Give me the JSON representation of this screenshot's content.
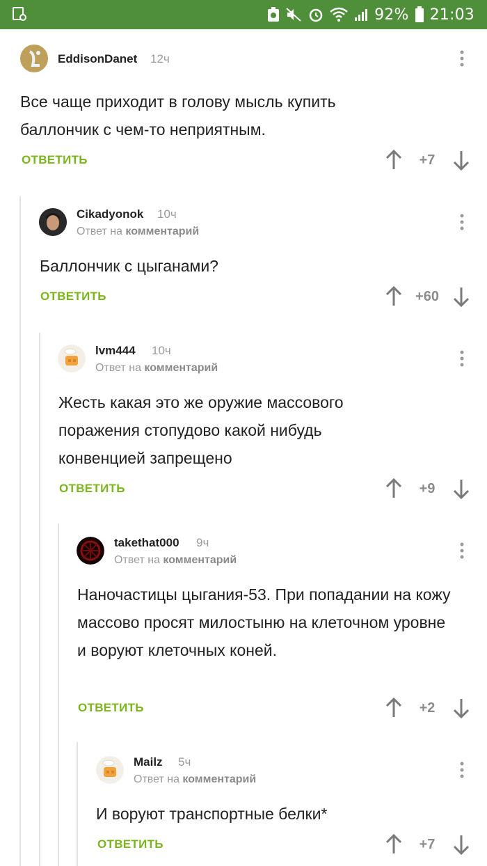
{
  "statusbar": {
    "battery": "92%",
    "time": "21:03"
  },
  "comments": [
    {
      "username": "EddisonDanet",
      "time": "12ч",
      "reply_to": "",
      "body": "Все чаще приходит в голову мысль купить баллончик с чем-то неприятным.",
      "reply_label": "ОТВЕТИТЬ",
      "score": "+7"
    },
    {
      "username": "Cikadyonok",
      "time": "10ч",
      "reply_to_prefix": "Ответ на",
      "reply_to": "комментарий",
      "body": "Баллончик с цыганами?",
      "reply_label": "ОТВЕТИТЬ",
      "score": "+60"
    },
    {
      "username": "lvm444",
      "time": "10ч",
      "reply_to_prefix": "Ответ на",
      "reply_to": "комментарий",
      "body": "Жесть какая это же оружие массового поражения стопудово какой нибудь конвенцией запрещено",
      "reply_label": "ОТВЕТИТЬ",
      "score": "+9"
    },
    {
      "username": "takethat000",
      "time": "9ч",
      "reply_to_prefix": "Ответ на",
      "reply_to": "комментарий",
      "body": "Наночастицы цыгания-53. При попадании на кожу массово просят милостыню на клеточном уровне и воруют клеточных коней.",
      "reply_label": "ОТВЕТИТЬ",
      "score": "+2"
    },
    {
      "username": "Mailz",
      "time": "5ч",
      "reply_to_prefix": "Ответ на",
      "reply_to": "комментарий",
      "body": "И воруют транспортные белки*",
      "reply_label": "ОТВЕТИТЬ",
      "score": "+7"
    }
  ]
}
